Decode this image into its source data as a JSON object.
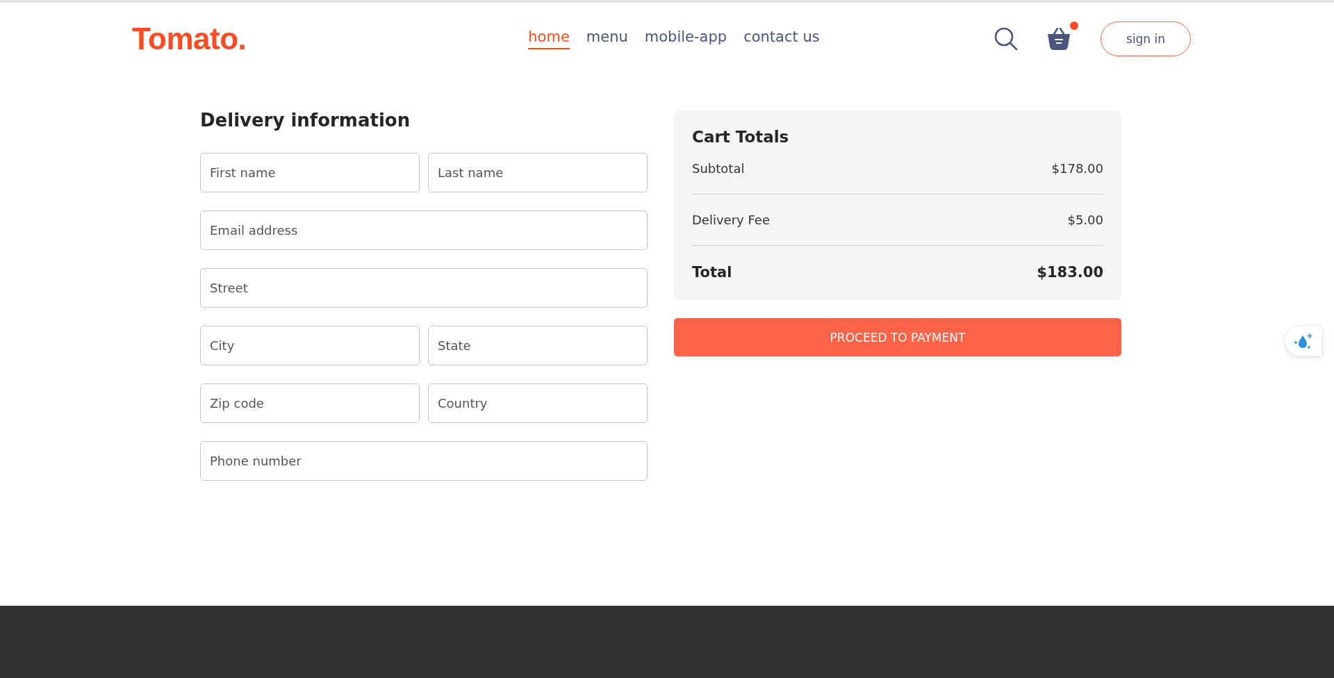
{
  "header": {
    "logo": "Tomato.",
    "nav": [
      {
        "label": "home",
        "selected": true
      },
      {
        "label": "menu",
        "selected": false
      },
      {
        "label": "mobile-app",
        "selected": false
      },
      {
        "label": "contact us",
        "selected": false
      }
    ],
    "cart_has_items": true,
    "sign_in": "sign in"
  },
  "delivery": {
    "title": "Delivery information",
    "rows": [
      [
        {
          "placeholder": "First name"
        },
        {
          "placeholder": "Last name"
        }
      ],
      [
        {
          "placeholder": "Email address"
        }
      ],
      [
        {
          "placeholder": "Street"
        }
      ],
      [
        {
          "placeholder": "City"
        },
        {
          "placeholder": "State"
        }
      ],
      [
        {
          "placeholder": "Zip code"
        },
        {
          "placeholder": "Country"
        }
      ],
      [
        {
          "placeholder": "Phone number"
        }
      ]
    ]
  },
  "cart_totals": {
    "title": "Cart Totals",
    "lines": [
      {
        "label": "Subtotal",
        "value": "$178.00",
        "kind": "normal"
      },
      {
        "label": "Delivery Fee",
        "value": "$5.00",
        "kind": "normal"
      },
      {
        "label": "Total",
        "value": "$183.00",
        "kind": "total"
      }
    ],
    "button": "PROCEED TO PAYMENT"
  }
}
